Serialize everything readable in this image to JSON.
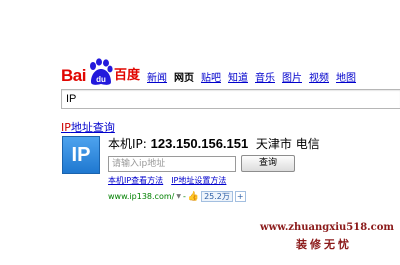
{
  "logo": {
    "bai": "Bai",
    "du_paw": "du",
    "cn": "百度"
  },
  "nav": {
    "items": [
      {
        "label": "新闻"
      },
      {
        "label": "网页",
        "current": true
      },
      {
        "label": "贴吧"
      },
      {
        "label": "知道"
      },
      {
        "label": "音乐"
      },
      {
        "label": "图片"
      },
      {
        "label": "视频"
      },
      {
        "label": "地图"
      }
    ]
  },
  "search": {
    "value": "IP"
  },
  "result": {
    "title_em": "IP",
    "title_rest": "地址查询",
    "icon_text": "IP",
    "local_label": "本机IP: ",
    "ip": "123.150.156.151",
    "location": "  天津市 电信",
    "input_placeholder": "请输入ip地址",
    "query_button": "查询",
    "link1": "本机IP查看方法",
    "link2": "IP地址设置方法",
    "url": "www.ip138.com/",
    "count": "25.2万"
  },
  "watermark": {
    "url": "www.zhuangxiu518.com",
    "name": "装修无忧"
  },
  "colors": {
    "link": "#0000cc",
    "brand_red": "#e10601",
    "url_green": "#008000",
    "icon_blue": "#1f78d0"
  }
}
